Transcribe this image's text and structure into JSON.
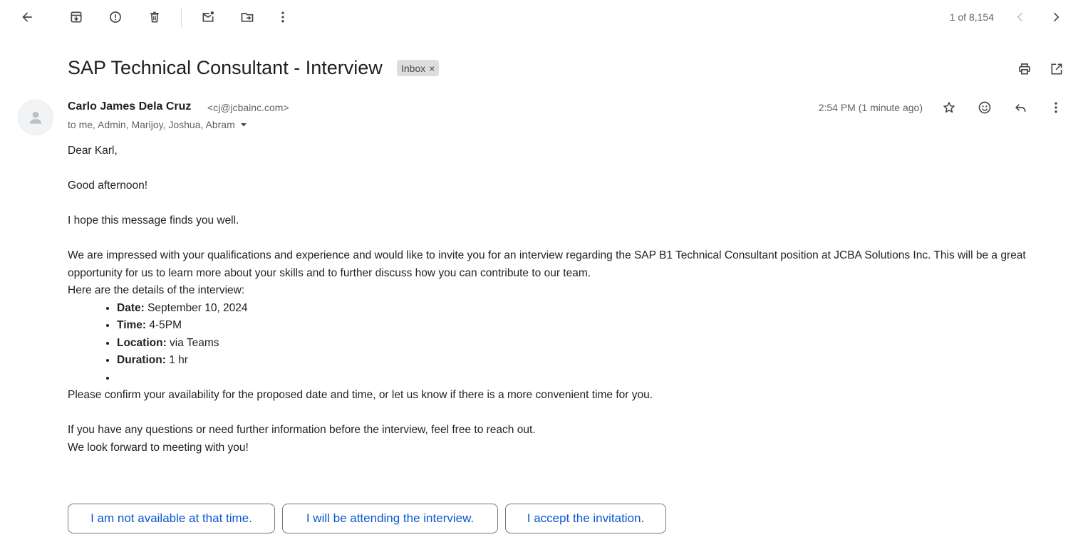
{
  "toolbar": {
    "back_icon": "arrow-left-icon",
    "archive_icon": "archive-icon",
    "spam_icon": "report-spam-icon",
    "delete_icon": "trash-icon",
    "mark_unread_icon": "mark-unread-icon",
    "move_icon": "move-to-folder-icon",
    "more_icon": "more-vert-icon"
  },
  "pager": {
    "text": "1 of 8,154",
    "prev_icon": "chevron-left-icon",
    "next_icon": "chevron-right-icon"
  },
  "thread": {
    "subject": "SAP Technical Consultant - Interview",
    "label": "Inbox",
    "label_remove": "×",
    "print_icon": "print-icon",
    "new_window_icon": "open-in-new-icon"
  },
  "message": {
    "sender_name": "Carlo James Dela Cruz",
    "sender_email": "<cj@jcbainc.com>",
    "recipients": "to me, Admin, Marijoy, Joshua, Abram",
    "timestamp": "2:54 PM (1 minute ago)",
    "star_icon": "star-icon",
    "emoji_icon": "emoji-reaction-icon",
    "reply_icon": "reply-icon",
    "more_icon": "more-vert-icon",
    "body": {
      "greeting": "Dear Karl,",
      "line1": "Good afternoon!",
      "line2": "I hope this message finds you well.",
      "para1": "We are impressed with your qualifications and experience and would like to invite you for an interview regarding the SAP B1 Technical Consultant position at JCBA Solutions Inc. This will be a great opportunity for us to learn more about your skills and to further discuss how you can contribute to our team.",
      "details_intro": "Here are the details of the interview:",
      "details": [
        {
          "label": "Date:",
          "value": " September 10, 2024"
        },
        {
          "label": "Time:",
          "value": " 4-5PM"
        },
        {
          "label": "Location:",
          "value": " via Teams"
        },
        {
          "label": "Duration:",
          "value": " 1 hr"
        }
      ],
      "confirm": "Please confirm your availability for the proposed date and time, or let us know if there is a more convenient time for you.",
      "questions": "If you have any questions or need further information before the interview, feel free to reach out.",
      "closing": "We look forward to meeting with you!"
    }
  },
  "smart_replies": [
    "I am not available at that time.",
    "I will be attending the interview.",
    "I accept the invitation."
  ],
  "colors": {
    "link_blue": "#0b57d0",
    "icon_gray": "#444746",
    "label_bg": "#dddddd"
  }
}
